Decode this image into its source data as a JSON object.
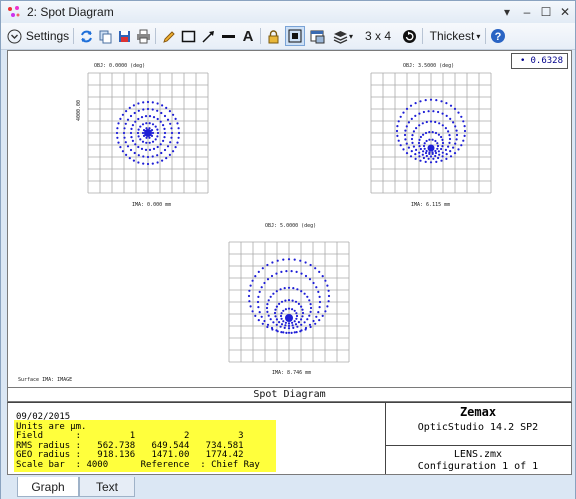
{
  "window": {
    "title": "2: Spot Diagram"
  },
  "toolbar": {
    "settings_label": "Settings",
    "layout_label": "3 x 4",
    "thickness_label": "Thickest"
  },
  "wavelength": {
    "value": "0.6328"
  },
  "plots": [
    {
      "obj_label": "OBJ: 0.0000 (deg)",
      "ima_label": "IMA: 0.000 mm",
      "scale_label": "4000.00"
    },
    {
      "obj_label": "OBJ: 3.5000 (deg)",
      "ima_label": "IMA: 6.115 mm"
    },
    {
      "obj_label": "OBJ: 5.0000 (deg)",
      "ima_label": "IMA: 8.746 mm"
    }
  ],
  "surface_label": "Surface IMA: IMAGE",
  "footer": {
    "title": "Spot Diagram"
  },
  "info": {
    "lines": [
      "09/02/2015",
      "Units are µm.",
      "Field      :         1         2         3",
      "RMS radius :   562.738   649.544   734.581",
      "GEO radius :   918.136   1471.00   1774.42",
      "Scale bar  : 4000      Reference  : Chief Ray"
    ],
    "company": "Zemax",
    "product": "OpticStudio 14.2 SP2",
    "file": "LENS.zmx",
    "config": "Configuration 1 of 1"
  },
  "tabs": [
    {
      "label": "Graph"
    },
    {
      "label": "Text"
    }
  ],
  "colors": {
    "spot": "#1f1fd6",
    "highlight": "#ffff3c"
  }
}
